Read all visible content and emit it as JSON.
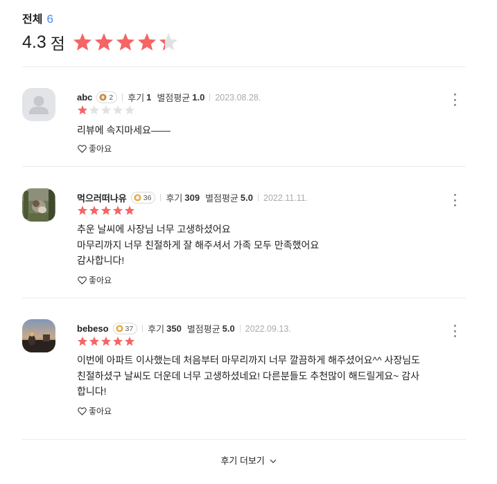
{
  "header": {
    "title": "전체",
    "count": "6"
  },
  "rating": {
    "score": "4.3",
    "unit": "점",
    "value": 4.3,
    "max": 5
  },
  "colors": {
    "star_filled": "#f56565",
    "star_empty": "#e2e2e2",
    "count_blue": "#4a86e8",
    "badge_bronze": "#c78a4a",
    "badge_gold": "#e0a93a"
  },
  "reviews": [
    {
      "name": "abc",
      "badge": "2",
      "badge_icon": "bronze-medal-icon",
      "reviews_label": "후기",
      "reviews_count": "1",
      "avg_label": "별점평균",
      "avg_value": "1.0",
      "date": "2023.08.28.",
      "stars": 1,
      "content": "리뷰에 속지마세요——",
      "like_label": "좋아요",
      "avatar": "default-avatar"
    },
    {
      "name": "먹으러떠나유",
      "badge": "36",
      "badge_icon": "gold-medal-icon",
      "reviews_label": "후기",
      "reviews_count": "309",
      "avg_label": "별점평균",
      "avg_value": "5.0",
      "date": "2022.11.11.",
      "stars": 5,
      "content": "추운 날씨에 사장님 너무 고생하셨어요\n마무리까지 너무 친절하게 잘 해주셔서 가족 모두 만족했어요\n감사합니다!",
      "like_label": "좋아요",
      "avatar": "photo-avatar"
    },
    {
      "name": "bebeso",
      "badge": "37",
      "badge_icon": "gold-medal-icon",
      "reviews_label": "후기",
      "reviews_count": "350",
      "avg_label": "별점평균",
      "avg_value": "5.0",
      "date": "2022.09.13.",
      "stars": 5,
      "content": "이번에 아파트 이사했는데 처음부터 마무리까지 너무 깔끔하게 해주셨어요^^ 사장님도\n친절하셨구 날씨도 더운데 너무 고생하셨네요! 다른분들도 추천많이 해드릴게요~ 감사\n합니다!",
      "like_label": "좋아요",
      "avatar": "photo-avatar"
    }
  ],
  "load_more": "후기 더보기"
}
